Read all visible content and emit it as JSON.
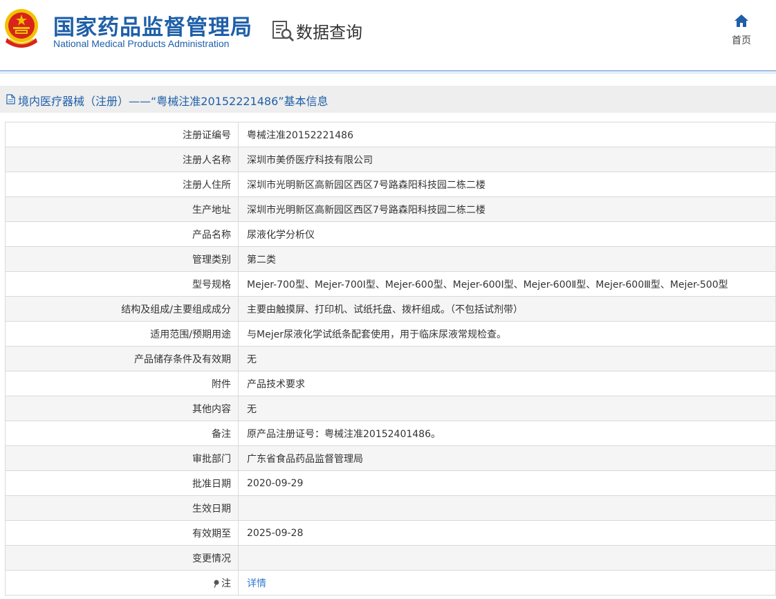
{
  "header": {
    "brand_cn": "国家药品监督管理局",
    "brand_en": "National Medical Products Administration",
    "query_title": "数据查询",
    "home_label": "首页",
    "icons": {
      "emblem": "national-emblem",
      "query": "document-search-icon",
      "home": "home-icon"
    }
  },
  "titlebar": {
    "icon": "document-icon",
    "text": "境内医疗器械（注册）——“粤械注准20152221486”基本信息"
  },
  "rows": [
    {
      "label": "注册证编号",
      "value": "粤械注准20152221486"
    },
    {
      "label": "注册人名称",
      "value": "深圳市美侨医疗科技有限公司"
    },
    {
      "label": "注册人住所",
      "value": "深圳市光明新区高新园区西区7号路森阳科技园二栋二楼"
    },
    {
      "label": "生产地址",
      "value": "深圳市光明新区高新园区西区7号路森阳科技园二栋二楼"
    },
    {
      "label": "产品名称",
      "value": "尿液化学分析仪"
    },
    {
      "label": "管理类别",
      "value": "第二类"
    },
    {
      "label": "型号规格",
      "value": "Mejer-700型、Mejer-700I型、Mejer-600型、Mejer-600I型、Mejer-600Ⅱ型、Mejer-600Ⅲ型、Mejer-500型"
    },
    {
      "label": "结构及组成/主要组成成分",
      "value": "主要由触摸屏、打印机、试纸托盘、拨杆组成。（不包括试剂带）"
    },
    {
      "label": "适用范围/预期用途",
      "value": "与Mejer尿液化学试纸条配套使用，用于临床尿液常规检查。"
    },
    {
      "label": "产品储存条件及有效期",
      "value": "无"
    },
    {
      "label": "附件",
      "value": "产品技术要求"
    },
    {
      "label": "其他内容",
      "value": "无"
    },
    {
      "label": "备注",
      "value": "原产品注册证号：粤械注准20152401486。"
    },
    {
      "label": "审批部门",
      "value": "广东省食品药品监督管理局"
    },
    {
      "label": "批准日期",
      "value": "2020-09-29"
    },
    {
      "label": "生效日期",
      "value": ""
    },
    {
      "label": "有效期至",
      "value": "2025-09-28"
    },
    {
      "label": "变更情况",
      "value": ""
    }
  ],
  "note_row": {
    "icon": "pushpin-icon",
    "label": "注",
    "link": "详情"
  },
  "colors": {
    "brand_blue": "#1e5fa8",
    "link_blue": "#2e7bd1",
    "emblem_red": "#d8241c",
    "emblem_gold": "#f2c200"
  }
}
